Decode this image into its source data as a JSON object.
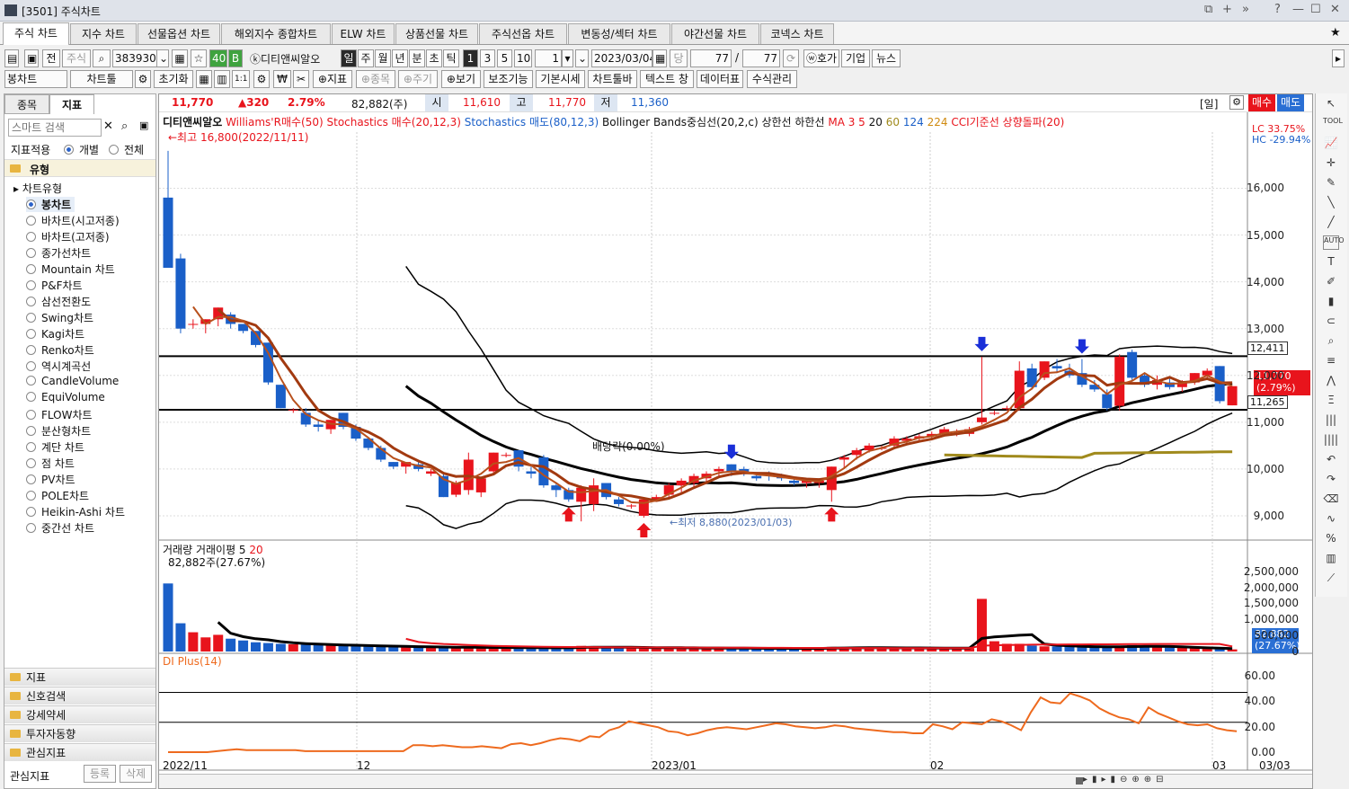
{
  "window": {
    "title": "[3501] 주식차트",
    "controls": [
      "⧉",
      "+",
      "»",
      "?",
      "—",
      "☐",
      "✕"
    ]
  },
  "tabs": [
    "주식 차트",
    "지수 차트",
    "선물옵션 차트",
    "해외지수 종합차트",
    "ELW 차트",
    "상품선물 차트",
    "주식선옵 차트",
    "변동성/섹터 차트",
    "야간선물 차트",
    "코넥스 차트"
  ],
  "toolbar1": {
    "all": "전",
    "stock_type": "주식",
    "code": "383930",
    "count1": "40",
    "b": "B",
    "stock_name": "ⓚ디티앤씨알오",
    "periods": [
      "일",
      "주",
      "월",
      "년",
      "분",
      "초",
      "틱"
    ],
    "p1": "1",
    "p3": "3",
    "p5": "5",
    "p10": "10",
    "interval": "1",
    "date": "2023/03/04",
    "tang": "당",
    "n1": "77",
    "slash": "/",
    "n2": "77",
    "hoga": "ⓦ호가",
    "company": "기업",
    "news": "뉴스"
  },
  "toolbar2": {
    "chart_type": "봉차트",
    "chart_tool": "차트툴",
    "reset": "초기화",
    "indicator": "지표",
    "item": "종목",
    "period": "주기",
    "view": "보기",
    "aux": "보조기능",
    "base_price": "기본시세",
    "chart_toolbar": "차트툴바",
    "text_window": "텍스트 창",
    "data_table": "데이터표",
    "formula": "수식관리",
    "one_one": "1:1"
  },
  "left_panel": {
    "tab_item": "종목",
    "tab_indicator": "지표",
    "search_placeholder": "스마트 검색",
    "apply_label": "지표적용",
    "apply_individual": "개별",
    "apply_all": "전체",
    "type_label": "유형",
    "chart_type_label": "차트유형",
    "items": [
      "봉차트",
      "바차트(시고저종)",
      "바차트(고저종)",
      "종가선차트",
      "Mountain 차트",
      "P&F차트",
      "삼선전환도",
      "Swing차트",
      "Kagi차트",
      "Renko차트",
      "역시계곡선",
      "CandleVolume",
      "EquiVolume",
      "FLOW차트",
      "분산형차트",
      "계단 차트",
      "점 차트",
      "PV차트",
      "POLE차트",
      "Heikin-Ashi 차트",
      "중간선 차트"
    ],
    "groups": [
      "지표",
      "신호검색",
      "강세약세",
      "투자자동향",
      "관심지표"
    ],
    "fav_label": "관심지표",
    "register": "등록",
    "delete": "삭제"
  },
  "quote": {
    "price": "11,770",
    "change": "▲320",
    "pct": "2.79%",
    "volume": "82,882(주)",
    "open_label": "시",
    "open": "11,610",
    "high_label": "고",
    "high": "11,770",
    "low_label": "저",
    "low": "11,360",
    "period": "[일]",
    "buy": "매수",
    "sell": "매도"
  },
  "legend": {
    "name": "디티앤씨알오",
    "williams": "Williams'R매수(50)",
    "stoch_buy": "Stochastics 매수(20,12,3)",
    "stoch_sell": "Stochastics 매도(80,12,3)",
    "bb": "Bollinger Bands중심선(20,2,c) 상한선 하한선",
    "ma_label": "MA 3 5",
    "ma20": "20",
    "ma60": "60",
    "ma124": "124",
    "ma224": "224",
    "cci": "CCI기준선 상향돌파(20)"
  },
  "annotations": {
    "high": "←최고 16,800(2022/11/11)",
    "low": "←최저 8,880(2023/01/03)",
    "dividend": "배당락(0.00%)",
    "lc": "LC  33.75%",
    "hc": "HC -29.94%"
  },
  "price_axis": [
    "16,000",
    "15,000",
    "14,000",
    "13,000",
    "12,000",
    "11,000",
    "10,000",
    "9,000"
  ],
  "price_tags": {
    "upper": "12,411",
    "current": "11,770",
    "current_pct": "(2.79%)",
    "lower": "11,265"
  },
  "volume": {
    "title": "거래량",
    "avg_title": "거래이평 5",
    "avg20": "20",
    "last": "82,882주(27.67%)",
    "axis": [
      "2,500,000",
      "2,000,000",
      "1,500,000",
      "1,000,000",
      "500,000",
      "0"
    ],
    "tag": "82,882",
    "tag_pct": "(27.67%)"
  },
  "dmi": {
    "title": "DI Plus(14)",
    "axis": [
      "60.00",
      "40.00",
      "20.00",
      "0.00"
    ]
  },
  "x_axis": [
    "2022/11",
    "12",
    "2023/01",
    "02",
    "03",
    "03/03"
  ],
  "colors": {
    "up": "#e8141c",
    "down": "#1a5fc8",
    "ma_brown": "#a23a10",
    "bb_black": "#000000",
    "ma_gold": "#a08a1c",
    "dmi": "#ee6a1e"
  },
  "chart_data": {
    "type": "candlestick",
    "candles": [
      [
        15800,
        16800,
        14600,
        14300
      ],
      [
        14500,
        14600,
        12900,
        13000
      ],
      [
        13100,
        13200,
        13000,
        13100
      ],
      [
        13100,
        13200,
        12900,
        13200
      ],
      [
        13200,
        13450,
        13050,
        13450
      ],
      [
        13300,
        13350,
        13000,
        13100
      ],
      [
        13100,
        13100,
        12900,
        12950
      ],
      [
        12950,
        12950,
        12600,
        12650
      ],
      [
        12700,
        12700,
        11800,
        11850
      ],
      [
        11800,
        11800,
        11300,
        11300
      ],
      [
        11250,
        11300,
        11200,
        11270
      ],
      [
        11200,
        11300,
        10900,
        10950
      ],
      [
        10950,
        11050,
        10800,
        10900
      ],
      [
        10850,
        11000,
        10750,
        11050
      ],
      [
        11200,
        11200,
        10850,
        10900
      ],
      [
        10900,
        10950,
        10600,
        10650
      ],
      [
        10650,
        10650,
        10400,
        10450
      ],
      [
        10450,
        10500,
        10150,
        10200
      ],
      [
        10150,
        10150,
        10000,
        10050
      ],
      [
        10050,
        10150,
        9900,
        10150
      ],
      [
        10100,
        10150,
        9950,
        10000
      ],
      [
        9900,
        10000,
        9850,
        9950
      ],
      [
        9850,
        9900,
        9400,
        9400
      ],
      [
        9450,
        9750,
        9400,
        9700
      ],
      [
        9550,
        10350,
        9450,
        10200
      ],
      [
        9500,
        9800,
        9400,
        9800
      ],
      [
        9950,
        10350,
        9900,
        10350
      ],
      [
        10300,
        10350,
        10250,
        10300
      ],
      [
        10400,
        10400,
        9950,
        10050
      ],
      [
        9950,
        10050,
        9800,
        9900
      ],
      [
        10250,
        10300,
        9600,
        9650
      ],
      [
        9650,
        9700,
        9400,
        9550
      ],
      [
        9550,
        9600,
        9300,
        9350
      ],
      [
        9300,
        9650,
        8880,
        9600
      ],
      [
        9250,
        9800,
        9100,
        9650
      ],
      [
        9700,
        9700,
        9350,
        9400
      ],
      [
        9350,
        9400,
        9200,
        9250
      ],
      [
        9200,
        9250,
        9150,
        9220
      ],
      [
        9000,
        9400,
        8960,
        9350
      ],
      [
        9330,
        9450,
        9300,
        9400
      ],
      [
        9450,
        9700,
        9350,
        9650
      ],
      [
        9650,
        9800,
        9500,
        9750
      ],
      [
        9700,
        9900,
        9600,
        9850
      ],
      [
        9800,
        9950,
        9700,
        9900
      ],
      [
        9950,
        10050,
        9850,
        10000
      ],
      [
        10100,
        10100,
        9850,
        9950
      ],
      [
        10000,
        10050,
        9850,
        9900
      ],
      [
        9850,
        9900,
        9750,
        9800
      ],
      [
        9900,
        9950,
        9750,
        9880
      ],
      [
        9850,
        9900,
        9750,
        9800
      ],
      [
        9750,
        9800,
        9650,
        9700
      ],
      [
        9700,
        9800,
        9600,
        9750
      ],
      [
        9700,
        9800,
        9600,
        9750
      ],
      [
        9550,
        10050,
        9300,
        10050
      ],
      [
        10200,
        10300,
        10000,
        10250
      ],
      [
        10300,
        10450,
        10200,
        10400
      ],
      [
        10400,
        10550,
        10350,
        10500
      ],
      [
        10450,
        10500,
        10400,
        10450
      ],
      [
        10500,
        10700,
        10450,
        10650
      ],
      [
        10600,
        10700,
        10550,
        10650
      ],
      [
        10650,
        10750,
        10600,
        10700
      ],
      [
        10700,
        10800,
        10650,
        10750
      ],
      [
        10750,
        10900,
        10700,
        10850
      ],
      [
        10800,
        10850,
        10700,
        10800
      ],
      [
        10750,
        10900,
        10700,
        10850
      ],
      [
        11000,
        12400,
        10950,
        11100
      ],
      [
        11200,
        11250,
        11150,
        11200
      ],
      [
        11300,
        11350,
        11250,
        11300
      ],
      [
        11300,
        12300,
        11250,
        12100
      ],
      [
        12150,
        12250,
        11700,
        11750
      ],
      [
        11950,
        12300,
        11900,
        12300
      ],
      [
        12200,
        12350,
        12050,
        12150
      ],
      [
        12100,
        12250,
        11950,
        12000
      ],
      [
        12050,
        12350,
        11750,
        11800
      ],
      [
        11800,
        11900,
        11650,
        11700
      ],
      [
        11600,
        11700,
        11250,
        11300
      ],
      [
        11350,
        12450,
        11250,
        12400
      ],
      [
        12500,
        12550,
        11900,
        11950
      ],
      [
        12000,
        12050,
        11750,
        11800
      ],
      [
        11800,
        12000,
        11700,
        11900
      ],
      [
        11850,
        11950,
        11700,
        11750
      ],
      [
        11750,
        11900,
        11650,
        11850
      ],
      [
        11850,
        12050,
        11800,
        12050
      ],
      [
        12000,
        12150,
        11950,
        12100
      ],
      [
        12200,
        12200,
        11400,
        11450
      ],
      [
        11360,
        11770,
        11360,
        11770
      ]
    ],
    "volume": [
      2650000,
      1100000,
      750000,
      550000,
      650000,
      500000,
      430000,
      360000,
      330000,
      300000,
      280000,
      270000,
      260000,
      240000,
      230000,
      220000,
      210000,
      200000,
      190000,
      180000,
      170000,
      170000,
      165000,
      160000,
      160000,
      155000,
      150000,
      150000,
      150000,
      145000,
      140000,
      140000,
      140000,
      220000,
      180000,
      150000,
      140000,
      150000,
      160000,
      145000,
      140000,
      140000,
      135000,
      130000,
      130000,
      125000,
      125000,
      120000,
      120000,
      120000,
      115000,
      115000,
      120000,
      180000,
      150000,
      145000,
      145000,
      140000,
      140000,
      135000,
      135000,
      130000,
      130000,
      125000,
      125000,
      2050000,
      400000,
      300000,
      300000,
      230000,
      200000,
      200000,
      190000,
      180000,
      170000,
      170000,
      200000,
      250000,
      200000,
      180000,
      150000,
      140000,
      130000,
      120000,
      110000,
      82882
    ],
    "dmi_plus": [
      0,
      0,
      0,
      0,
      0,
      1,
      2,
      3,
      2,
      2,
      2,
      2,
      2,
      2,
      1,
      1,
      1,
      1,
      1,
      1,
      1,
      1,
      1,
      1,
      1,
      7,
      7,
      6,
      7,
      6,
      5,
      5,
      6,
      5,
      4,
      8,
      9,
      7,
      9,
      12,
      14,
      13,
      11,
      16,
      15,
      22,
      25,
      31,
      29,
      27,
      25,
      21,
      20,
      17,
      19,
      22,
      24,
      25,
      24,
      23,
      25,
      27,
      29,
      28,
      26,
      25,
      24,
      25,
      27,
      26,
      24,
      23,
      22,
      21,
      20,
      20,
      19,
      19,
      28,
      26,
      23,
      30,
      29,
      28,
      33,
      31,
      27,
      22,
      40,
      55,
      50,
      49,
      59,
      56,
      52,
      44,
      39,
      35,
      33,
      29,
      45,
      39,
      35,
      31,
      28,
      27,
      28,
      24,
      22,
      21
    ],
    "ma_lines": [
      "MA3",
      "MA5",
      "MA20",
      "MA60",
      "MA124",
      "MA224"
    ],
    "bollinger": {
      "period": 20,
      "k": 2
    },
    "ylim": [
      8500,
      17200
    ],
    "volume_ylim": [
      0,
      2800000
    ],
    "dmi_ylim": [
      0,
      65
    ],
    "h_lines": [
      12411,
      11265
    ]
  }
}
